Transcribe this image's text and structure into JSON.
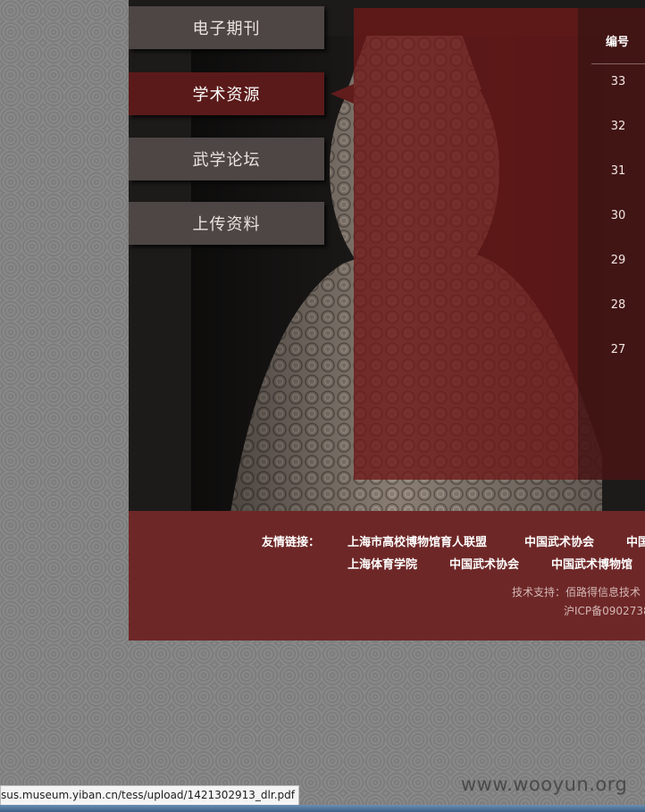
{
  "nav": {
    "items": [
      {
        "label": "电子期刊"
      },
      {
        "label": "学术资源"
      },
      {
        "label": "武学论坛"
      },
      {
        "label": "上传资料"
      }
    ],
    "active_index": 1
  },
  "table": {
    "header": "编号",
    "rows": [
      "33",
      "32",
      "31",
      "30",
      "29",
      "28",
      "27"
    ]
  },
  "footer": {
    "links_label": "友情链接：",
    "links": [
      "上海市高校博物馆育人联盟",
      "中国武术协会",
      "中国",
      "上海体育学院",
      "中国武术协会",
      "中国武术博物馆"
    ],
    "tech_support": "技术支持：佰路得信息技术",
    "icp": "沪ICP备0902738"
  },
  "status_bar": {
    "url": "sus.museum.yiban.cn/tess/upload/1421302913_dlr.pdf"
  },
  "watermark": "www.wooyun.org",
  "colors": {
    "page_bg": "#848484",
    "nav_default": "#4d4644",
    "nav_active": "#5a1a19",
    "panel": "#6e1818",
    "footer": "#6e2727"
  }
}
